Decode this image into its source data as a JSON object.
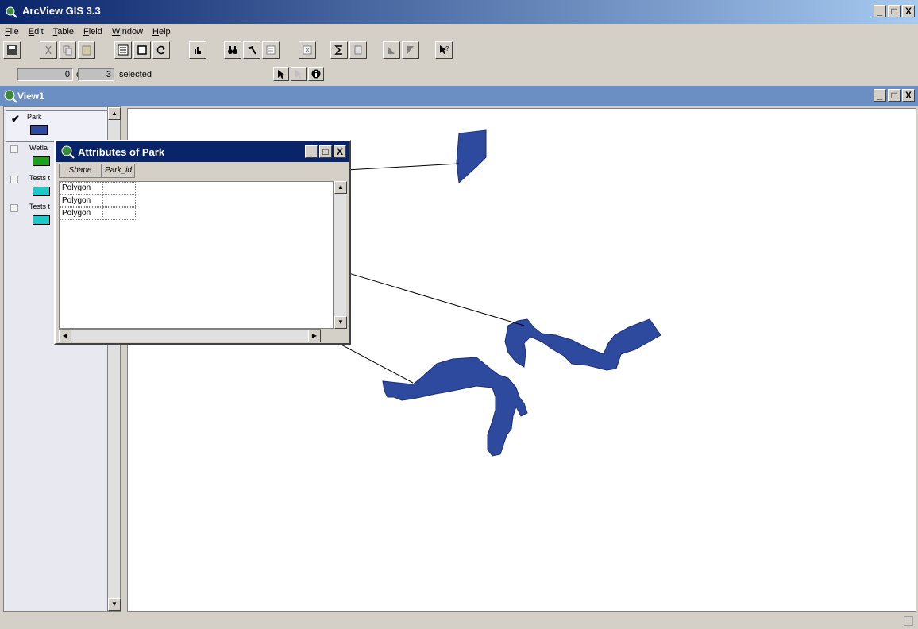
{
  "app": {
    "title": "ArcView GIS 3.3"
  },
  "menu": [
    {
      "label": "File",
      "key": "F",
      "rest": "ile"
    },
    {
      "label": "Edit",
      "key": "E",
      "rest": "dit"
    },
    {
      "label": "Table",
      "key": "T",
      "rest": "able"
    },
    {
      "label": "Field",
      "key": "F",
      "rest": "ield"
    },
    {
      "label": "Window",
      "key": "W",
      "rest": "indow"
    },
    {
      "label": "Help",
      "key": "H",
      "rest": "elp"
    }
  ],
  "status": {
    "selected_count": "0",
    "of_label": "of",
    "total": "3",
    "selected_label": "selected"
  },
  "view": {
    "title": "View1",
    "legend": [
      {
        "label": "Park",
        "checked": true,
        "color": "#2e4a9e"
      },
      {
        "label": "Wetla",
        "checked": false,
        "color": "#1ea01e"
      },
      {
        "label": "Tests t",
        "checked": false,
        "color": "#1ec8c8"
      },
      {
        "label": "Tests t",
        "checked": false,
        "color": "#1ec8c8"
      }
    ]
  },
  "attributes_window": {
    "title": "Attributes of Park",
    "columns": [
      "Shape",
      "Park_id"
    ],
    "rows": [
      {
        "shape": "Polygon",
        "park_id": ""
      },
      {
        "shape": "Polygon",
        "park_id": ""
      },
      {
        "shape": "Polygon",
        "park_id": ""
      }
    ]
  },
  "colors": {
    "polygon_fill": "#2e4a9e",
    "title_bar": "#0a246a",
    "view_bar": "#6b8fc2"
  }
}
